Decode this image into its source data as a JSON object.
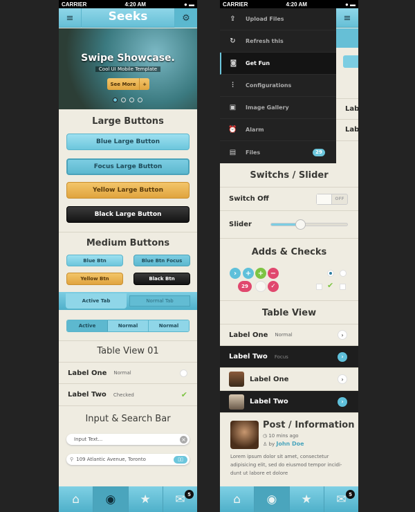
{
  "status": {
    "carrier": "CARRIER",
    "time": "4:20 AM"
  },
  "left": {
    "app_title": "Seeks",
    "hero": {
      "title": "Swipe Showcase.",
      "subtitle": "Cool UI Mobile Template",
      "button": "See More",
      "plus": "+",
      "pages": 4,
      "active_page": 1
    },
    "large": {
      "title": "Large Buttons",
      "blue": "Blue Large Button",
      "focus": "Focus Large Button",
      "yellow": "Yellow Large Button",
      "black": "Black Large Button"
    },
    "medium": {
      "title": "Medium Buttons",
      "blue": "Blue Btn",
      "focus": "Blue Btn Focus",
      "yellow": "Yellow Btn",
      "black": "Black Btn"
    },
    "tabs": {
      "active": "Active Tab",
      "normal": "Normal Tab"
    },
    "segments": [
      "Active",
      "Normal",
      "Normal"
    ],
    "table": {
      "title": "Table View 01",
      "rows": [
        {
          "label": "Label One",
          "sub": "Normal",
          "checked": false
        },
        {
          "label": "Label Two",
          "sub": "Checked",
          "checked": true
        }
      ]
    },
    "inputs": {
      "title": "Input & Search Bar",
      "input_placeholder": "Input Text...",
      "search_value": "109 Atlantic Avenue, Toronto"
    },
    "tabbar": {
      "badge": "5"
    }
  },
  "right": {
    "menu": [
      {
        "icon": "upload-icon",
        "label": "Upload Files"
      },
      {
        "icon": "refresh-icon",
        "label": "Refresh this"
      },
      {
        "icon": "gamepad-icon",
        "label": "Get Fun",
        "active": true
      },
      {
        "icon": "sliders-icon",
        "label": "Configurations"
      },
      {
        "icon": "image-icon",
        "label": "Image Gallery"
      },
      {
        "icon": "alarm-icon",
        "label": "Alarm"
      },
      {
        "icon": "files-icon",
        "label": "Files",
        "badge": "29"
      }
    ],
    "behind_rows": [
      "Labe",
      "Labe"
    ],
    "switch": {
      "title": "Switchs / Slider",
      "label": "Switch Off",
      "state": "OFF",
      "slider_label": "Slider",
      "slider_value": 0.39
    },
    "adds": {
      "title": "Adds & Checks",
      "badge": "29"
    },
    "table": {
      "title": "Table View",
      "rows": [
        {
          "label": "Label One",
          "sub": "Normal"
        },
        {
          "label": "Label Two",
          "sub": "Focus"
        },
        {
          "label": "Label One"
        },
        {
          "label": "Label Two"
        }
      ]
    },
    "post": {
      "title": "Post / Information",
      "time": "10 mins ago",
      "by": "by",
      "author": "John Doe",
      "body": "Lorem ipsum dolor sit amet, consectetur adipisicing elit, sed do eiusmod tempor incidi- dunt ut labore et dolore"
    },
    "tabbar": {
      "badge": "5"
    }
  },
  "colors": {
    "accent": "#6cc6dc",
    "yellow": "#e0a43e",
    "pink": "#e0486e",
    "green": "#7dc443"
  }
}
